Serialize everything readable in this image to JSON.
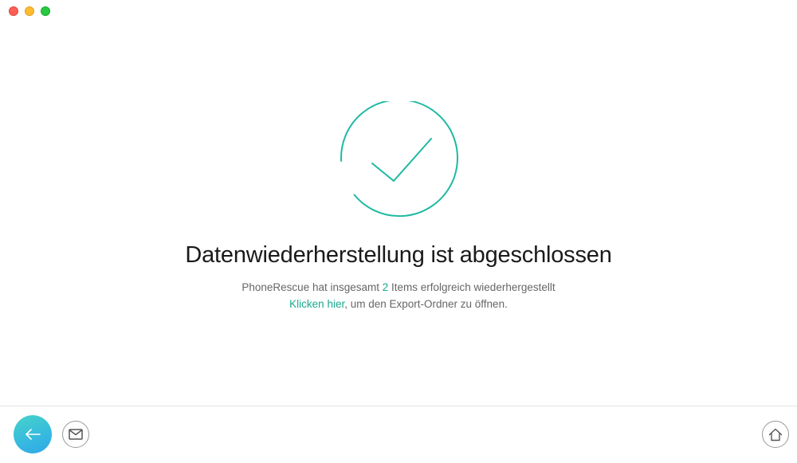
{
  "window": {
    "controls": [
      "close",
      "minimize",
      "maximize"
    ]
  },
  "status": {
    "icon": "checkmark-circle-icon",
    "color": "#1fb9a2"
  },
  "main": {
    "title": "Datenwiederherstellung ist abgeschlossen",
    "summary_prefix": "PhoneRescue hat insgesamt ",
    "item_count": "2",
    "summary_suffix": " Items erfolgreich wiederhergestellt",
    "link_text": "Klicken hier",
    "link_suffix": ", um den Export-Ordner zu öffnen."
  },
  "footer": {
    "back_icon": "arrow-left-icon",
    "mail_icon": "mail-icon",
    "home_icon": "home-icon"
  }
}
